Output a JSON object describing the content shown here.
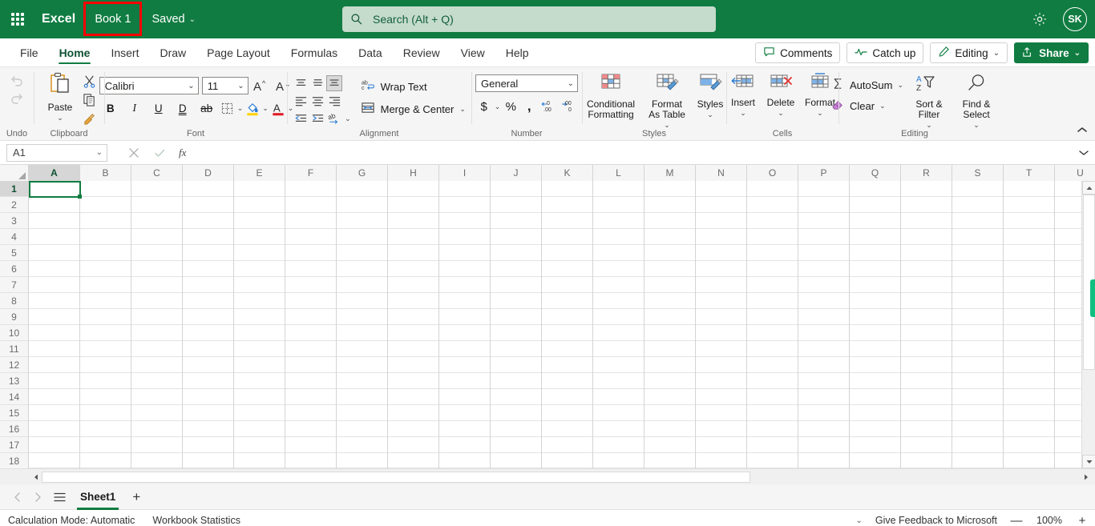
{
  "titlebar": {
    "waffle_icon": "app-launcher-icon",
    "app_name": "Excel",
    "doc_title": "Book 1",
    "save_state": "Saved",
    "save_chevron": "⌄",
    "search_placeholder": "Search (Alt + Q)",
    "search_value": "",
    "search_icon": "search-icon",
    "settings_icon": "gear-icon",
    "avatar_initials": "SK",
    "bg_color": "#107c41",
    "highlight_color": "#ff0000"
  },
  "tabs": [
    {
      "label": "File",
      "active": false
    },
    {
      "label": "Home",
      "active": true
    },
    {
      "label": "Insert",
      "active": false
    },
    {
      "label": "Draw",
      "active": false
    },
    {
      "label": "Page Layout",
      "active": false
    },
    {
      "label": "Formulas",
      "active": false
    },
    {
      "label": "Data",
      "active": false
    },
    {
      "label": "Review",
      "active": false
    },
    {
      "label": "View",
      "active": false
    },
    {
      "label": "Help",
      "active": false
    }
  ],
  "tab_actions": {
    "comments": "Comments",
    "catchup": "Catch up",
    "editing": "Editing",
    "share": "Share",
    "chevron": "⌄"
  },
  "ribbon": {
    "collapse_icon": "chevron-up-icon",
    "groups": {
      "undo": {
        "label": "Undo",
        "undo_icon": "undo-arrow-icon",
        "redo_icon": "redo-arrow-icon"
      },
      "clipboard": {
        "label": "Clipboard",
        "paste": "Paste",
        "paste_chevron": "⌄",
        "cut_icon": "scissors-icon",
        "copy_icon": "copy-icon",
        "format_painter_icon": "format-painter-icon"
      },
      "font": {
        "label": "Font",
        "font_family": "Calibri",
        "font_size": "11",
        "chevron": "⌄",
        "grow_font": "A",
        "shrink_font": "A",
        "bold": "B",
        "italic": "I",
        "underline": "U",
        "double_underline": "D",
        "strikethrough": "ab",
        "borders_icon": "borders-icon",
        "fill_color_icon": "fill-color-icon",
        "font_color_icon": "font-color-icon",
        "fill_color": "#ffd400",
        "font_color": "#e01b24"
      },
      "alignment": {
        "label": "Alignment",
        "wrap_text": "Wrap Text",
        "merge_center": "Merge & Center",
        "merge_chevron": "⌄",
        "align_top_icon": "align-top-icon",
        "align_middle_icon": "align-middle-icon",
        "align_bottom_icon": "align-bottom-icon",
        "align_left_icon": "align-left-icon",
        "align_center_icon": "align-center-icon",
        "align_right_icon": "align-right-icon",
        "decrease_indent_icon": "decrease-indent-icon",
        "increase_indent_icon": "increase-indent-icon",
        "orientation_icon": "text-orientation-icon",
        "wrap_text_icon": "wrap-text-icon",
        "merge_icon": "merge-cells-icon"
      },
      "number": {
        "label": "Number",
        "format": "General",
        "chevron": "⌄",
        "currency_icon": "currency-icon",
        "percent_icon": "percent-icon",
        "comma_icon": "comma-style-icon",
        "increase_decimal_icon": "increase-decimal-icon",
        "decrease_decimal_icon": "decrease-decimal-icon"
      },
      "styles": {
        "label": "Styles",
        "conditional_formatting": "Conditional Formatting",
        "format_as_table": "Format As Table",
        "styles": "Styles",
        "chevron": "⌄",
        "conditional_icon": "conditional-formatting-icon",
        "table_icon": "format-as-table-icon",
        "styles_icon": "cell-styles-icon"
      },
      "cells": {
        "label": "Cells",
        "insert": "Insert",
        "delete": "Delete",
        "format": "Format",
        "chevron": "⌄",
        "insert_icon": "insert-cells-icon",
        "delete_icon": "delete-cells-icon",
        "format_icon": "format-cells-icon"
      },
      "editing": {
        "label": "Editing",
        "autosum": "AutoSum",
        "clear": "Clear",
        "sort_filter": "Sort & Filter",
        "find_select": "Find & Select",
        "chevron": "⌄",
        "autosum_icon": "sigma-icon",
        "clear_icon": "eraser-icon",
        "sort_filter_icon": "sort-filter-icon",
        "find_icon": "magnifier-icon"
      }
    }
  },
  "formulabar": {
    "name_box": "A1",
    "name_box_chevron": "⌄",
    "cancel_icon": "cancel-x-icon",
    "confirm_icon": "confirm-check-icon",
    "function_icon": "fx-icon",
    "formula_value": "",
    "expand_icon": "chevron-down-icon"
  },
  "grid": {
    "columns": [
      "A",
      "B",
      "C",
      "D",
      "E",
      "F",
      "G",
      "H",
      "I",
      "J",
      "K",
      "L",
      "M",
      "N",
      "O",
      "P",
      "Q",
      "R",
      "S",
      "T",
      "U"
    ],
    "rows": [
      1,
      2,
      3,
      4,
      5,
      6,
      7,
      8,
      9,
      10,
      11,
      12,
      13,
      14,
      15,
      16,
      17,
      18
    ],
    "selected_cell": "A1",
    "selected_column": "A",
    "selected_row": 1,
    "select_all_icon": "select-all-corner-icon",
    "scroll_up_icon": "scroll-up-arrow-icon",
    "scroll_down_icon": "scroll-down-arrow-icon",
    "scroll_left_icon": "scroll-left-arrow-icon",
    "scroll_right_icon": "scroll-right-arrow-icon",
    "selection_color": "#107c41"
  },
  "sheettabs": {
    "prev_icon": "chevron-left-icon",
    "next_icon": "chevron-right-icon",
    "all_sheets_icon": "all-sheets-icon",
    "sheets": [
      {
        "name": "Sheet1",
        "active": true
      }
    ],
    "add_icon": "+"
  },
  "statusbar": {
    "calculation_mode": "Calculation Mode: Automatic",
    "workbook_statistics": "Workbook Statistics",
    "options_chevron": "⌄",
    "feedback": "Give Feedback to Microsoft",
    "zoom_out": "—",
    "zoom_level": "100%",
    "zoom_in": "+"
  }
}
